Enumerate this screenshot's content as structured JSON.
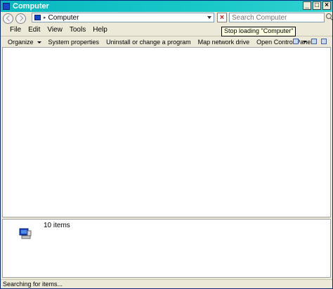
{
  "window": {
    "title": "Computer"
  },
  "titlebar": {
    "minimize": "_",
    "maximize": "□",
    "close": "×"
  },
  "address": {
    "location": "Computer"
  },
  "search": {
    "placeholder": "Search Computer"
  },
  "tooltip": {
    "text": "Stop loading \"Computer\""
  },
  "menu": {
    "items": [
      "File",
      "Edit",
      "View",
      "Tools",
      "Help"
    ]
  },
  "commands": {
    "organize": "Organize",
    "system_properties": "System properties",
    "uninstall": "Uninstall or change a program",
    "map_drive": "Map network drive",
    "control_panel": "Open Control Panel"
  },
  "details": {
    "item_count": "10 items"
  },
  "status": {
    "text": "Searching for items..."
  }
}
